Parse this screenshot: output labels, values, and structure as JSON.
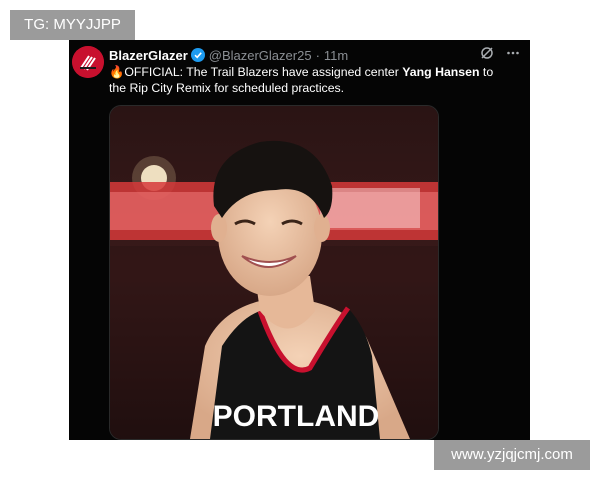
{
  "watermark": {
    "tg": "TG: MYYJJPP",
    "site": "www.yzjqjcmj.com"
  },
  "tweet": {
    "display_name": "BlazerGlazer",
    "handle": "@BlazerGlazer25",
    "separator": "·",
    "time": "11m",
    "text_emoji": "🔥",
    "text_part1": "OFFICIAL: The Trail Blazers have assigned center ",
    "text_bold": "Yang Hansen",
    "text_part2": " to the Rip City Remix for scheduled practices.",
    "jersey_text": "PORTLAND",
    "avatar_icon": "trail-blazers-pinwheel-logo",
    "colors": {
      "background": "#050505",
      "verified": "#1d9bf0",
      "brand": "#c8102e"
    }
  }
}
